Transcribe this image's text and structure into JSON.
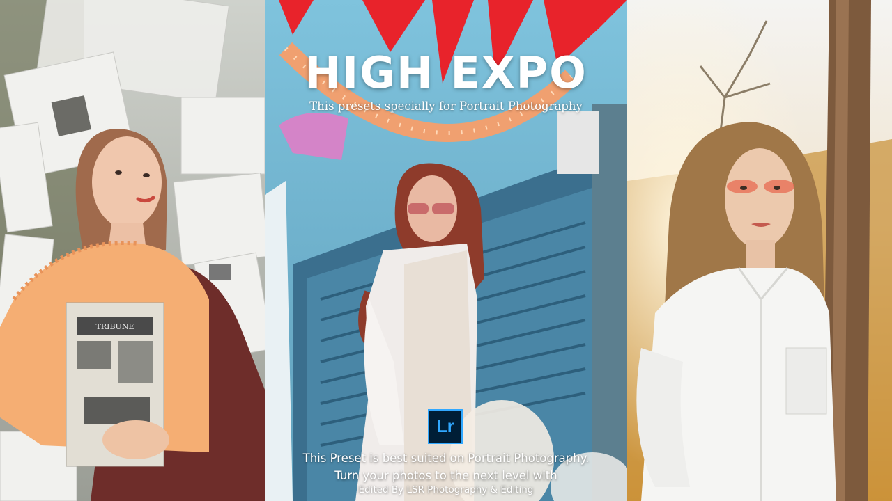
{
  "title": "HIGH EXPO",
  "subtitle": "This presets specially for Portrait Photography",
  "app_badge": "Lr",
  "caption_line1": "This Preset is best suited on Portrait Photography.",
  "caption_line2": "Turn your photos to the next level with",
  "caption_line3": "Edited By LSR Photography & Editing",
  "newspaper_masthead": "TRIBUNE",
  "colors": {
    "title_text": "#ffffff",
    "badge_bg": "#001e36",
    "badge_accent": "#31a8ff"
  }
}
